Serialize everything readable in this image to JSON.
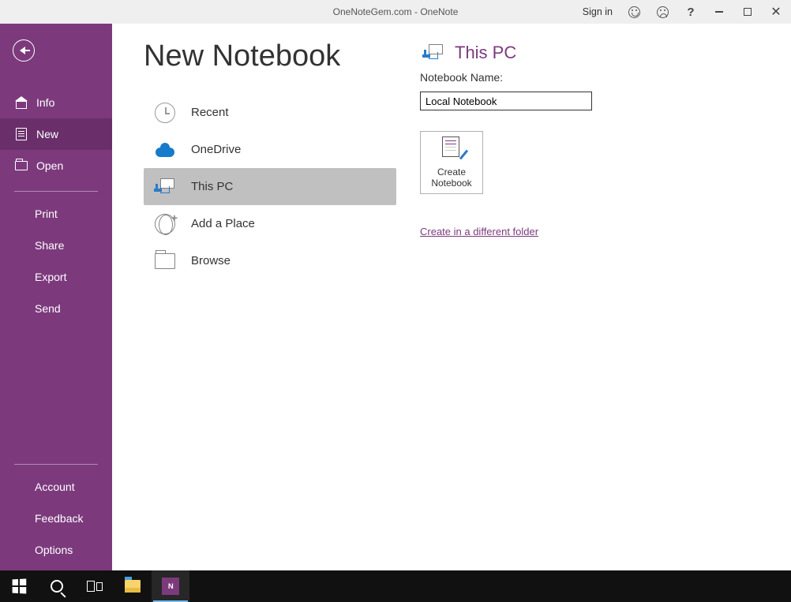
{
  "title_bar": {
    "title": "OneNoteGem.com  -  OneNote",
    "signin": "Sign in"
  },
  "sidebar": {
    "items": [
      {
        "label": "Info"
      },
      {
        "label": "New"
      },
      {
        "label": "Open"
      }
    ],
    "second_group": [
      {
        "label": "Print"
      },
      {
        "label": "Share"
      },
      {
        "label": "Export"
      },
      {
        "label": "Send"
      }
    ],
    "bottom_group": [
      {
        "label": "Account"
      },
      {
        "label": "Feedback"
      },
      {
        "label": "Options"
      }
    ]
  },
  "page": {
    "title": "New Notebook",
    "locations": [
      {
        "label": "Recent"
      },
      {
        "label": "OneDrive"
      },
      {
        "label": "This PC"
      },
      {
        "label": "Add a Place"
      },
      {
        "label": "Browse"
      }
    ]
  },
  "right": {
    "header": "This PC",
    "name_label": "Notebook Name:",
    "name_value": "Local Notebook",
    "create_label_line1": "Create",
    "create_label_line2": "Notebook",
    "different_link": "Create in a different folder"
  },
  "colors": {
    "accent": "#7c3a7d"
  }
}
